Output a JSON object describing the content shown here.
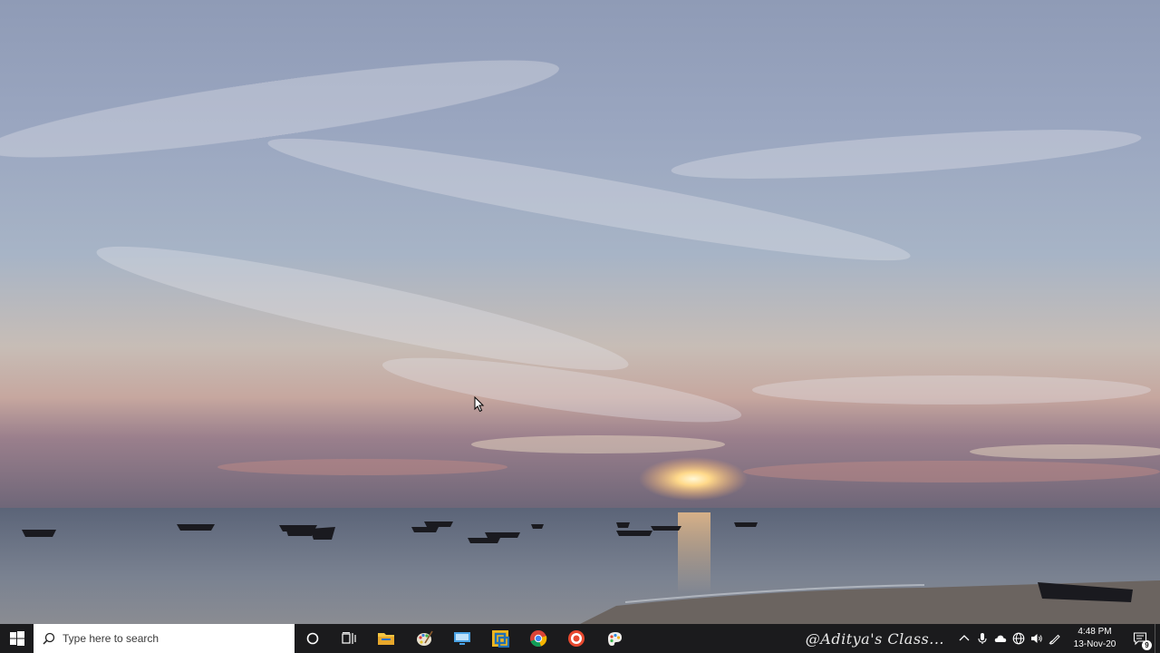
{
  "desktop": {
    "wallpaper": "sunset-over-sea-with-boats"
  },
  "taskbar": {
    "start_icon": "windows-logo-icon",
    "search": {
      "placeholder": "Type here to search",
      "icon": "search-icon"
    },
    "pinned_apps": [
      {
        "name": "cortana",
        "icon": "circle-icon"
      },
      {
        "name": "task-view",
        "icon": "task-view-icon"
      },
      {
        "name": "file-explorer",
        "icon": "folder-icon"
      },
      {
        "name": "paint",
        "icon": "palette-icon"
      },
      {
        "name": "remote-desktop",
        "icon": "monitor-icon"
      },
      {
        "name": "app-yellow",
        "icon": "square-app-icon"
      },
      {
        "name": "chrome",
        "icon": "chrome-icon"
      },
      {
        "name": "recorder",
        "icon": "record-icon"
      },
      {
        "name": "paint-3d",
        "icon": "paint3d-icon"
      }
    ],
    "watermark": "@Aditya's Class...",
    "tray": {
      "icons": [
        "chevron-up-icon",
        "microphone-icon",
        "cloud-icon",
        "globe-icon",
        "speaker-icon",
        "pen-icon"
      ]
    },
    "clock": {
      "time": "4:48 PM",
      "date": "13-Nov-20"
    },
    "notifications": {
      "count": "9"
    }
  },
  "colors": {
    "taskbar_bg": "#1b1b1d",
    "search_bg": "#ffffff"
  }
}
